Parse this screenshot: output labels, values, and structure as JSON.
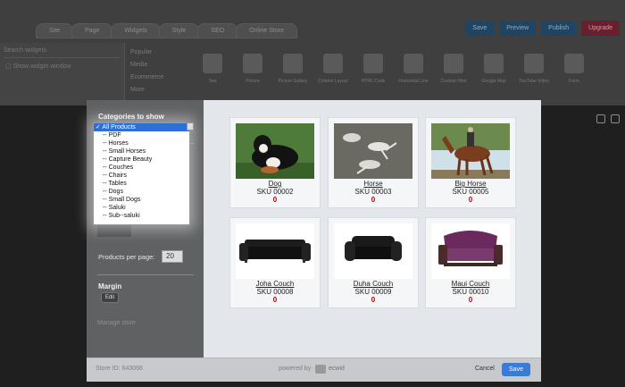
{
  "editor": {
    "tabs": [
      "Site",
      "Page",
      "Widgets",
      "Style",
      "SEO",
      "Online Store"
    ],
    "actions": [
      {
        "label": "Save",
        "color": "blue"
      },
      {
        "label": "Preview",
        "color": "blue"
      },
      {
        "label": "Publish",
        "color": "blue"
      },
      {
        "label": "Upgrade",
        "color": "red"
      }
    ],
    "search_placeholder": "Search widgets",
    "show_label": "Show widget window",
    "categories": [
      "Popular",
      "Media",
      "Ecommerce",
      "More"
    ],
    "widgets": [
      "Text",
      "Picture",
      "Picture Gallery",
      "Column Layout",
      "HTML Code",
      "Horizontal Line",
      "Custom Html",
      "Google Map",
      "YouTube Video",
      "Form",
      "Online Store"
    ]
  },
  "modal": {
    "categories_label": "Categories to show",
    "dropdown_options": [
      "✓ All Products",
      "-- PDF",
      "-- Horses",
      "-- Small Horses",
      "-- Capture Beauty",
      "-- Couches",
      "-- Chairs",
      "-- Tables",
      "-- Dogs",
      "-- Small Dogs",
      "-- Saluki",
      "-- Sub--saluki"
    ],
    "products_per_page_label": "Products per page:",
    "products_per_page_value": "20",
    "margin_label": "Margin",
    "edit_label": "Edit",
    "manage_store_label": "Manage store",
    "store_id": "Store ID:  643066",
    "powered_by": "powered by",
    "brand": "ecwid",
    "cancel_label": "Cancel",
    "save_label": "Save"
  },
  "products": [
    {
      "name": "Dog",
      "sku": "SKU 00002",
      "price": "0",
      "image": "dog"
    },
    {
      "name": "Horse",
      "sku": "SKU 00003",
      "price": "0",
      "image": "horse-dogs"
    },
    {
      "name": "Big Horse",
      "sku": "SKU 00005",
      "price": "0",
      "image": "big-horse"
    },
    {
      "name": "Joha Couch",
      "sku": "SKU 00008",
      "price": "0",
      "image": "couch"
    },
    {
      "name": "Duha Couch",
      "sku": "SKU 00009",
      "price": "0",
      "image": "couch"
    },
    {
      "name": "Maui Couch",
      "sku": "SKU 00010",
      "price": "0",
      "image": "purple-couch"
    }
  ]
}
